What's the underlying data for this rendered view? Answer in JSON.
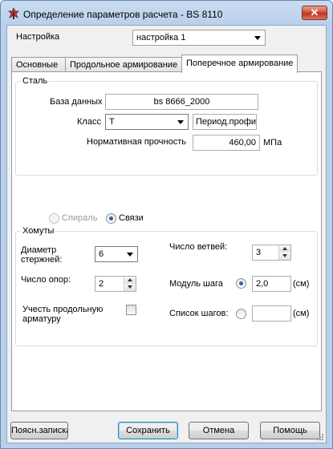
{
  "window": {
    "title": "Определение параметров расчета - BS 8110",
    "close_glyph": "✕",
    "icon": "app-icon"
  },
  "settings": {
    "label": "Настройка",
    "value": "настройка 1"
  },
  "tabs": [
    {
      "label": "Основные",
      "active": false
    },
    {
      "label": "Продольное армирование",
      "active": false
    },
    {
      "label": "Поперечное армирование",
      "active": true
    }
  ],
  "steel": {
    "title": "Сталь",
    "database_label": "База данных",
    "database_value": "bs 8666_2000",
    "class_label": "Класс",
    "class_value": "T",
    "profile_value": "Период.профиль",
    "strength_label": "Нормативная прочность",
    "strength_value": "460,00",
    "strength_unit": "МПа"
  },
  "reinforcement_type": {
    "spiral_label": "Спираль",
    "ties_label": "Связи",
    "selected": "ties"
  },
  "stirrups": {
    "title": "Хомуты",
    "diameter_label_1": "Диаметр",
    "diameter_label_2": "стержней:",
    "diameter_value": "6",
    "branches_label": "Число ветвей:",
    "branches_value": "3",
    "supports_label": "Число опор:",
    "supports_value": "2",
    "step_module_label": "Модуль шага",
    "step_module_value": "2,0",
    "step_module_unit": "(см)",
    "longitudinal_label_1": "Учесть продольную",
    "longitudinal_label_2": "арматуру",
    "longitudinal_checked": false,
    "step_list_label": "Список шагов:",
    "step_list_value": "",
    "step_list_unit": "(см)",
    "step_mode": "module"
  },
  "buttons": {
    "note": "Поясн.записка",
    "save": "Сохранить",
    "cancel": "Отмена",
    "help": "Помощь"
  }
}
